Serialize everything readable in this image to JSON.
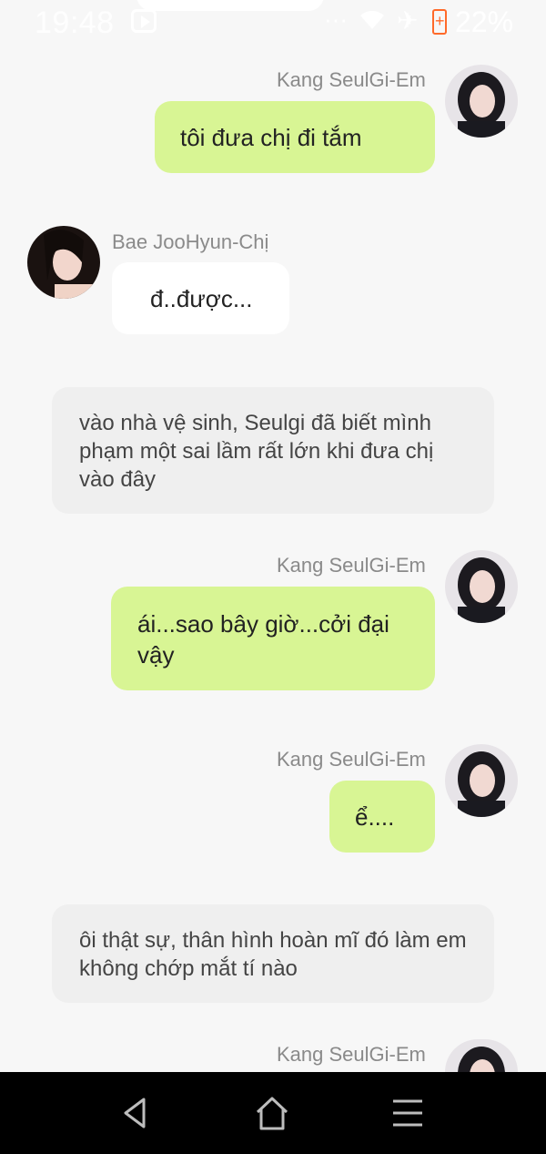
{
  "status_bar": {
    "time": "19:48",
    "battery_percent": "22%",
    "icons": [
      "youtube-icon",
      "more-dots-icon",
      "wifi-icon",
      "airplane-icon",
      "battery-charging-icon"
    ]
  },
  "messages": [
    {
      "type": "right",
      "sender": "Kang SeulGi-Em",
      "text": "tôi đưa chị đi tắm"
    },
    {
      "type": "left",
      "sender": "Bae JooHyun-Chị",
      "text": "đ..được..."
    },
    {
      "type": "narration",
      "text": "vào nhà vệ sinh, Seulgi đã biết mình phạm một sai lầm rất lớn khi đưa chị vào đây"
    },
    {
      "type": "right",
      "sender": "Kang SeulGi-Em",
      "text": "ái...sao bây giờ...cởi đại vậy"
    },
    {
      "type": "right",
      "sender": "Kang SeulGi-Em",
      "text": "ể...."
    },
    {
      "type": "narration",
      "text": "ôi thật sự, thân hình hoàn mĩ đó làm em không chớp mắt tí nào"
    },
    {
      "type": "right",
      "sender": "Kang SeulGi-Em",
      "text": ""
    }
  ],
  "nav_bar": {
    "buttons": [
      "back-icon",
      "home-icon",
      "menu-icon"
    ]
  },
  "colors": {
    "background": "#f7f7f7",
    "right_bubble": "#d8f594",
    "left_bubble": "#ffffff",
    "narration": "#efefef",
    "sender_name": "#8a8a8a",
    "battery": "#ff6a2a"
  }
}
